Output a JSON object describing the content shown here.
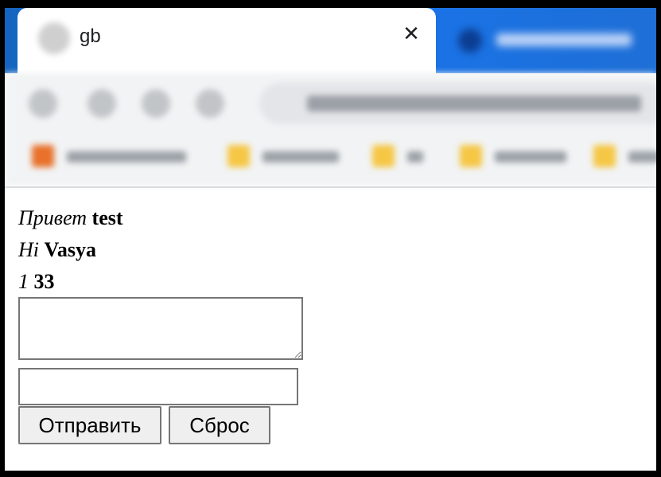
{
  "browser": {
    "tab_title": "gb",
    "tab_close_icon": "close-icon",
    "colors": {
      "tab_strip": "#1a73e8",
      "toolbar": "#f1f3f4"
    }
  },
  "page": {
    "lines": [
      {
        "label": "Привет",
        "value": "test"
      },
      {
        "label": "Hi",
        "value": "Vasya"
      },
      {
        "label": "1",
        "value": "33"
      }
    ],
    "textarea": {
      "value": ""
    },
    "text_input": {
      "value": ""
    },
    "submit_label": "Отправить",
    "reset_label": "Сброс"
  }
}
